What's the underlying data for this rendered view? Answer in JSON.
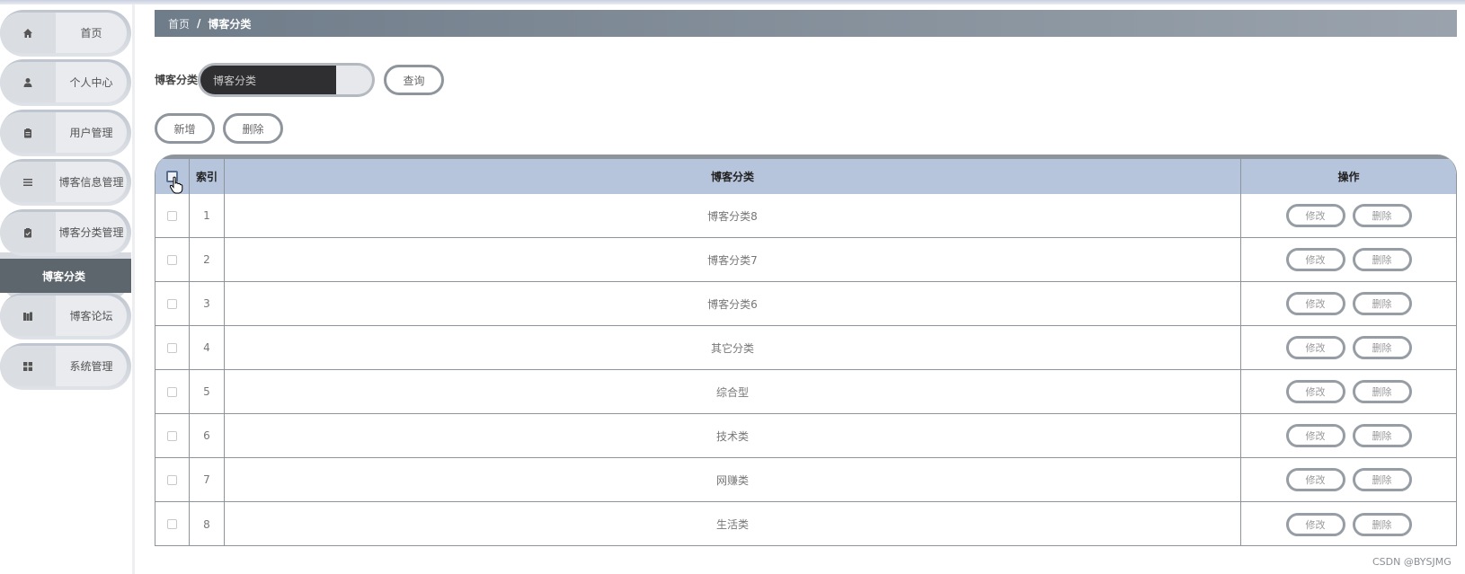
{
  "sidebar": {
    "items": [
      {
        "label": "首页",
        "icon": "home-icon"
      },
      {
        "label": "个人中心",
        "icon": "person-icon"
      },
      {
        "label": "用户管理",
        "icon": "clipboard-icon"
      },
      {
        "label": "博客信息管理",
        "icon": "list-icon"
      },
      {
        "label": "博客分类管理",
        "icon": "clipboard-check-icon"
      },
      {
        "label": "博客论坛",
        "icon": "books-icon"
      },
      {
        "label": "系统管理",
        "icon": "grid-icon"
      }
    ],
    "submenu_label": "博客分类"
  },
  "breadcrumb": {
    "home": "首页",
    "separator": "/",
    "current": "博客分类"
  },
  "search": {
    "label": "博客分类",
    "placeholder": "博客分类",
    "button": "查询"
  },
  "toolbar": {
    "add": "新增",
    "delete": "删除"
  },
  "table": {
    "headers": {
      "index": "索引",
      "name": "博客分类",
      "actions": "操作"
    },
    "rows": [
      {
        "index": "1",
        "name": "博客分类8"
      },
      {
        "index": "2",
        "name": "博客分类7"
      },
      {
        "index": "3",
        "name": "博客分类6"
      },
      {
        "index": "4",
        "name": "其它分类"
      },
      {
        "index": "5",
        "name": "综合型"
      },
      {
        "index": "6",
        "name": "技术类"
      },
      {
        "index": "7",
        "name": "网赚类"
      },
      {
        "index": "8",
        "name": "生活类"
      }
    ],
    "edit_label": "修改",
    "delete_label": "删除"
  },
  "watermark": "CSDN @BYSJMG",
  "colors": {
    "header_bg": "#b7c5dc",
    "breadcrumb_bg": "#6f7c89",
    "submenu_bg": "#5d656d",
    "search_field_bg": "#2f2f31"
  }
}
